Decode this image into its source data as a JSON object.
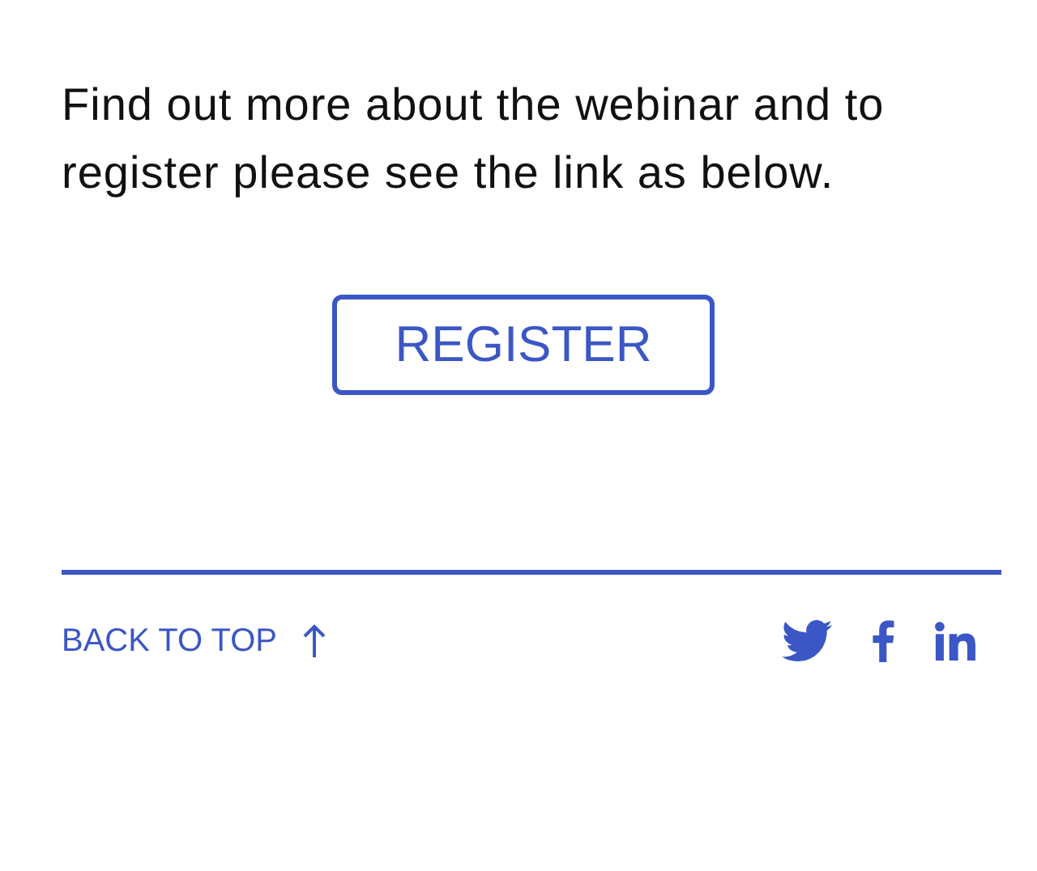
{
  "intro": {
    "text": "Find out more about the webinar and to register please see the link as below."
  },
  "register_button": {
    "label": "REGISTER"
  },
  "footer": {
    "back_to_top": {
      "label": "BACK TO TOP"
    },
    "social": [
      {
        "kind": "twitter"
      },
      {
        "kind": "facebook"
      },
      {
        "kind": "linkedin"
      }
    ]
  }
}
